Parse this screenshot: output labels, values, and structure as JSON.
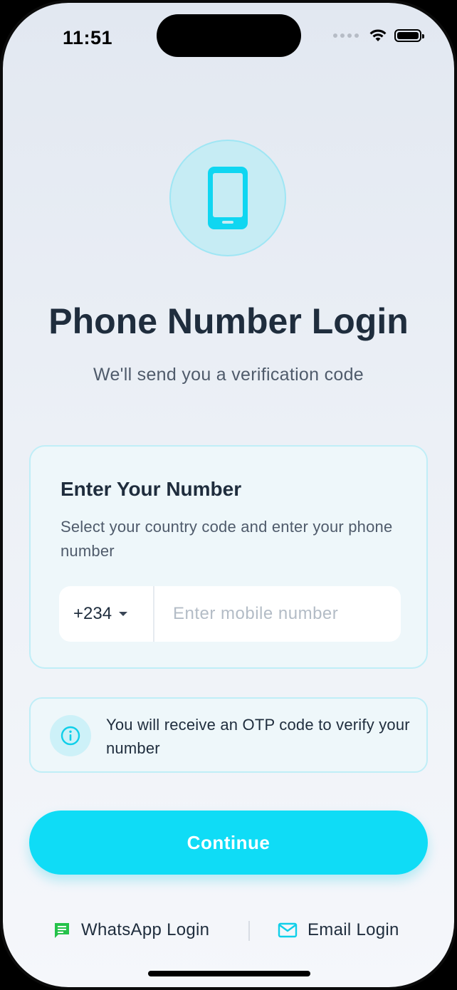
{
  "status_bar": {
    "time": "11:51"
  },
  "hero": {
    "icon": "smartphone-icon",
    "title": "Phone Number Login",
    "subtitle": "We'll send you a verification code"
  },
  "card": {
    "title": "Enter Your Number",
    "description": "Select your country code and enter your phone number",
    "country_code": "+234",
    "phone_value": "",
    "phone_placeholder": "Enter mobile number"
  },
  "info": {
    "icon": "info-icon",
    "text": "You will receive an OTP code to verify your number"
  },
  "continue_label": "Continue",
  "links": {
    "whatsapp_label": "WhatsApp Login",
    "whatsapp_icon": "chat-bubble-icon",
    "email_label": "Email Login",
    "email_icon": "mail-icon"
  },
  "colors": {
    "accent": "#0fdcf6",
    "title_text": "#1f2d3d",
    "whatsapp_green": "#25c24a"
  }
}
